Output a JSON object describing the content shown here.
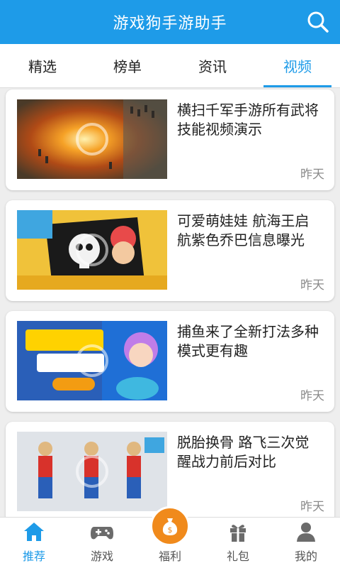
{
  "header": {
    "title": "游戏狗手游助手",
    "search_icon": "search-icon"
  },
  "tabs": [
    {
      "label": "精选",
      "active": false
    },
    {
      "label": "榜单",
      "active": false
    },
    {
      "label": "资讯",
      "active": false
    },
    {
      "label": "视频",
      "active": true
    }
  ],
  "videos": [
    {
      "title": "横扫千军手游所有武将技能视频演示",
      "time": "昨天"
    },
    {
      "title": "可爱萌娃娃 航海王启航紫色乔巴信息曝光",
      "time": "昨天"
    },
    {
      "title": "捕鱼来了全新打法多种模式更有趣",
      "time": "昨天"
    },
    {
      "title": "脱胎换骨 路飞三次觉醒战力前后对比",
      "time": "昨天"
    }
  ],
  "bottom_nav": [
    {
      "label": "推荐",
      "icon": "home-icon",
      "active": true
    },
    {
      "label": "游戏",
      "icon": "gamepad-icon",
      "active": false
    },
    {
      "label": "福利",
      "icon": "money-bag-icon",
      "active": false
    },
    {
      "label": "礼包",
      "icon": "gift-icon",
      "active": false
    },
    {
      "label": "我的",
      "icon": "user-icon",
      "active": false
    }
  ],
  "colors": {
    "primary": "#1e9be8",
    "accent": "#f08a1c"
  }
}
